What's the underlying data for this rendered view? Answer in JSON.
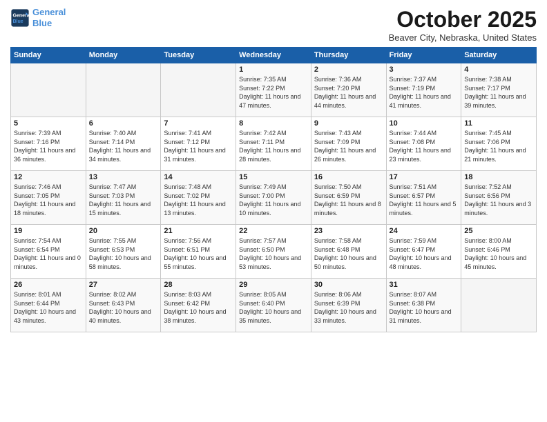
{
  "header": {
    "logo_line1": "General",
    "logo_line2": "Blue",
    "month": "October 2025",
    "location": "Beaver City, Nebraska, United States"
  },
  "days_of_week": [
    "Sunday",
    "Monday",
    "Tuesday",
    "Wednesday",
    "Thursday",
    "Friday",
    "Saturday"
  ],
  "weeks": [
    [
      {
        "num": "",
        "sunrise": "",
        "sunset": "",
        "daylight": "",
        "empty": true
      },
      {
        "num": "",
        "sunrise": "",
        "sunset": "",
        "daylight": "",
        "empty": true
      },
      {
        "num": "",
        "sunrise": "",
        "sunset": "",
        "daylight": "",
        "empty": true
      },
      {
        "num": "1",
        "sunrise": "Sunrise: 7:35 AM",
        "sunset": "Sunset: 7:22 PM",
        "daylight": "Daylight: 11 hours and 47 minutes.",
        "empty": false
      },
      {
        "num": "2",
        "sunrise": "Sunrise: 7:36 AM",
        "sunset": "Sunset: 7:20 PM",
        "daylight": "Daylight: 11 hours and 44 minutes.",
        "empty": false
      },
      {
        "num": "3",
        "sunrise": "Sunrise: 7:37 AM",
        "sunset": "Sunset: 7:19 PM",
        "daylight": "Daylight: 11 hours and 41 minutes.",
        "empty": false
      },
      {
        "num": "4",
        "sunrise": "Sunrise: 7:38 AM",
        "sunset": "Sunset: 7:17 PM",
        "daylight": "Daylight: 11 hours and 39 minutes.",
        "empty": false
      }
    ],
    [
      {
        "num": "5",
        "sunrise": "Sunrise: 7:39 AM",
        "sunset": "Sunset: 7:16 PM",
        "daylight": "Daylight: 11 hours and 36 minutes.",
        "empty": false
      },
      {
        "num": "6",
        "sunrise": "Sunrise: 7:40 AM",
        "sunset": "Sunset: 7:14 PM",
        "daylight": "Daylight: 11 hours and 34 minutes.",
        "empty": false
      },
      {
        "num": "7",
        "sunrise": "Sunrise: 7:41 AM",
        "sunset": "Sunset: 7:12 PM",
        "daylight": "Daylight: 11 hours and 31 minutes.",
        "empty": false
      },
      {
        "num": "8",
        "sunrise": "Sunrise: 7:42 AM",
        "sunset": "Sunset: 7:11 PM",
        "daylight": "Daylight: 11 hours and 28 minutes.",
        "empty": false
      },
      {
        "num": "9",
        "sunrise": "Sunrise: 7:43 AM",
        "sunset": "Sunset: 7:09 PM",
        "daylight": "Daylight: 11 hours and 26 minutes.",
        "empty": false
      },
      {
        "num": "10",
        "sunrise": "Sunrise: 7:44 AM",
        "sunset": "Sunset: 7:08 PM",
        "daylight": "Daylight: 11 hours and 23 minutes.",
        "empty": false
      },
      {
        "num": "11",
        "sunrise": "Sunrise: 7:45 AM",
        "sunset": "Sunset: 7:06 PM",
        "daylight": "Daylight: 11 hours and 21 minutes.",
        "empty": false
      }
    ],
    [
      {
        "num": "12",
        "sunrise": "Sunrise: 7:46 AM",
        "sunset": "Sunset: 7:05 PM",
        "daylight": "Daylight: 11 hours and 18 minutes.",
        "empty": false
      },
      {
        "num": "13",
        "sunrise": "Sunrise: 7:47 AM",
        "sunset": "Sunset: 7:03 PM",
        "daylight": "Daylight: 11 hours and 15 minutes.",
        "empty": false
      },
      {
        "num": "14",
        "sunrise": "Sunrise: 7:48 AM",
        "sunset": "Sunset: 7:02 PM",
        "daylight": "Daylight: 11 hours and 13 minutes.",
        "empty": false
      },
      {
        "num": "15",
        "sunrise": "Sunrise: 7:49 AM",
        "sunset": "Sunset: 7:00 PM",
        "daylight": "Daylight: 11 hours and 10 minutes.",
        "empty": false
      },
      {
        "num": "16",
        "sunrise": "Sunrise: 7:50 AM",
        "sunset": "Sunset: 6:59 PM",
        "daylight": "Daylight: 11 hours and 8 minutes.",
        "empty": false
      },
      {
        "num": "17",
        "sunrise": "Sunrise: 7:51 AM",
        "sunset": "Sunset: 6:57 PM",
        "daylight": "Daylight: 11 hours and 5 minutes.",
        "empty": false
      },
      {
        "num": "18",
        "sunrise": "Sunrise: 7:52 AM",
        "sunset": "Sunset: 6:56 PM",
        "daylight": "Daylight: 11 hours and 3 minutes.",
        "empty": false
      }
    ],
    [
      {
        "num": "19",
        "sunrise": "Sunrise: 7:54 AM",
        "sunset": "Sunset: 6:54 PM",
        "daylight": "Daylight: 11 hours and 0 minutes.",
        "empty": false
      },
      {
        "num": "20",
        "sunrise": "Sunrise: 7:55 AM",
        "sunset": "Sunset: 6:53 PM",
        "daylight": "Daylight: 10 hours and 58 minutes.",
        "empty": false
      },
      {
        "num": "21",
        "sunrise": "Sunrise: 7:56 AM",
        "sunset": "Sunset: 6:51 PM",
        "daylight": "Daylight: 10 hours and 55 minutes.",
        "empty": false
      },
      {
        "num": "22",
        "sunrise": "Sunrise: 7:57 AM",
        "sunset": "Sunset: 6:50 PM",
        "daylight": "Daylight: 10 hours and 53 minutes.",
        "empty": false
      },
      {
        "num": "23",
        "sunrise": "Sunrise: 7:58 AM",
        "sunset": "Sunset: 6:48 PM",
        "daylight": "Daylight: 10 hours and 50 minutes.",
        "empty": false
      },
      {
        "num": "24",
        "sunrise": "Sunrise: 7:59 AM",
        "sunset": "Sunset: 6:47 PM",
        "daylight": "Daylight: 10 hours and 48 minutes.",
        "empty": false
      },
      {
        "num": "25",
        "sunrise": "Sunrise: 8:00 AM",
        "sunset": "Sunset: 6:46 PM",
        "daylight": "Daylight: 10 hours and 45 minutes.",
        "empty": false
      }
    ],
    [
      {
        "num": "26",
        "sunrise": "Sunrise: 8:01 AM",
        "sunset": "Sunset: 6:44 PM",
        "daylight": "Daylight: 10 hours and 43 minutes.",
        "empty": false
      },
      {
        "num": "27",
        "sunrise": "Sunrise: 8:02 AM",
        "sunset": "Sunset: 6:43 PM",
        "daylight": "Daylight: 10 hours and 40 minutes.",
        "empty": false
      },
      {
        "num": "28",
        "sunrise": "Sunrise: 8:03 AM",
        "sunset": "Sunset: 6:42 PM",
        "daylight": "Daylight: 10 hours and 38 minutes.",
        "empty": false
      },
      {
        "num": "29",
        "sunrise": "Sunrise: 8:05 AM",
        "sunset": "Sunset: 6:40 PM",
        "daylight": "Daylight: 10 hours and 35 minutes.",
        "empty": false
      },
      {
        "num": "30",
        "sunrise": "Sunrise: 8:06 AM",
        "sunset": "Sunset: 6:39 PM",
        "daylight": "Daylight: 10 hours and 33 minutes.",
        "empty": false
      },
      {
        "num": "31",
        "sunrise": "Sunrise: 8:07 AM",
        "sunset": "Sunset: 6:38 PM",
        "daylight": "Daylight: 10 hours and 31 minutes.",
        "empty": false
      },
      {
        "num": "",
        "sunrise": "",
        "sunset": "",
        "daylight": "",
        "empty": true
      }
    ]
  ]
}
